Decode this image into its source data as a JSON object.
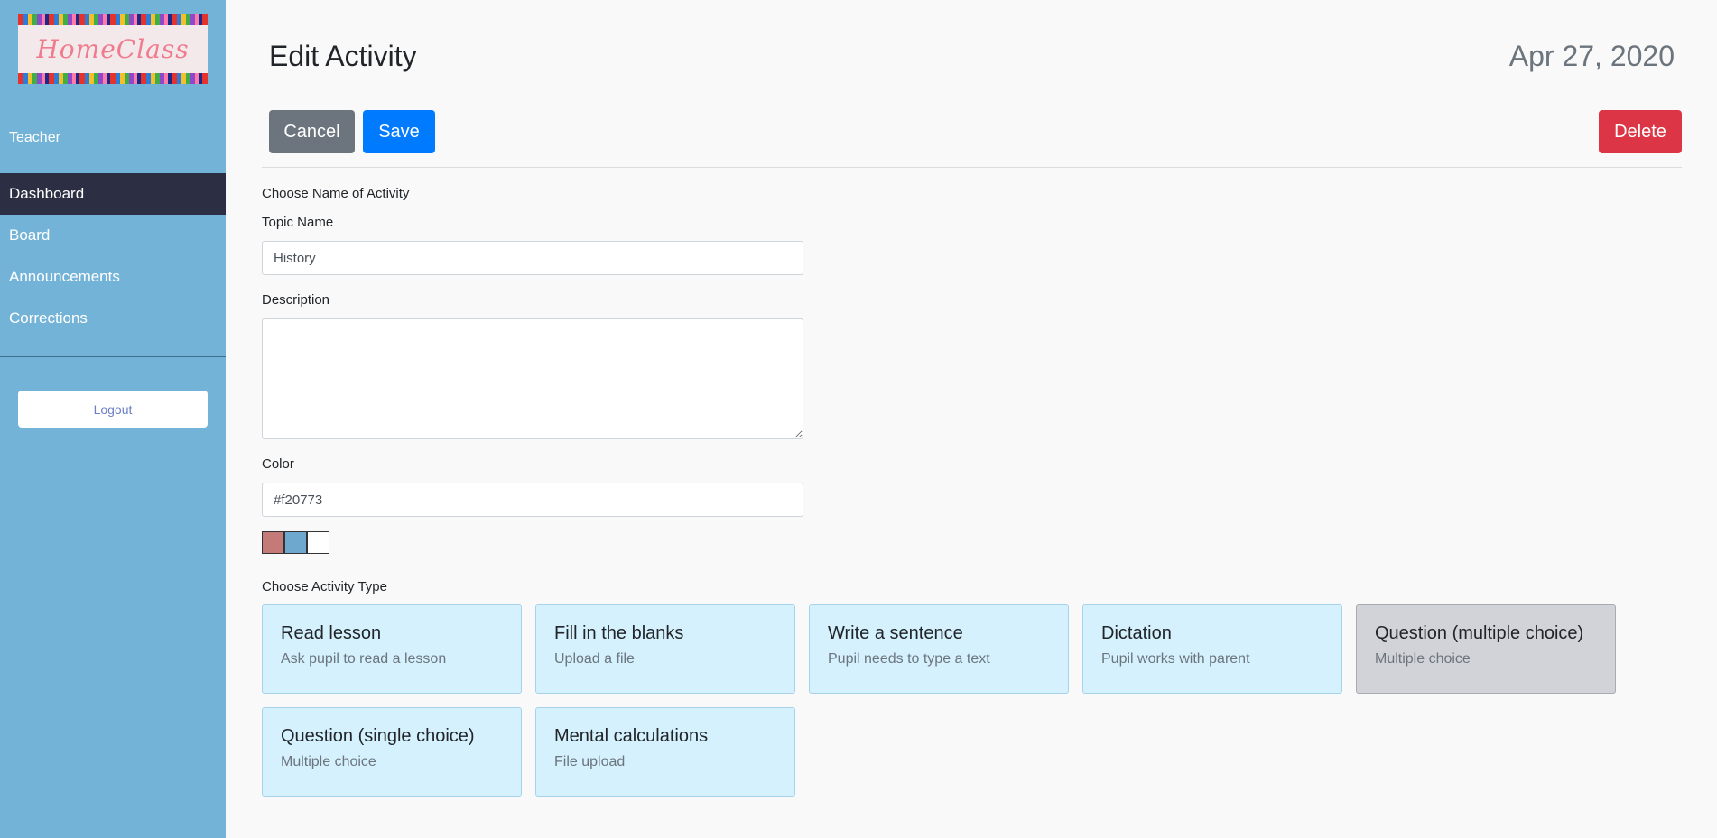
{
  "sidebar": {
    "logo_text": "HomeClass",
    "role": "Teacher",
    "nav": [
      {
        "label": "Dashboard",
        "active": true
      },
      {
        "label": "Board"
      },
      {
        "label": "Announcements"
      },
      {
        "label": "Corrections"
      }
    ],
    "logout_label": "Logout"
  },
  "header": {
    "title": "Edit Activity",
    "date": "Apr 27, 2020"
  },
  "toolbar": {
    "cancel_label": "Cancel",
    "save_label": "Save",
    "delete_label": "Delete"
  },
  "form": {
    "section_name_label": "Choose Name of Activity",
    "topic_label": "Topic Name",
    "topic_value": "History",
    "description_label": "Description",
    "description_value": "",
    "color_label": "Color",
    "color_value": "#f20773",
    "swatches": [
      "#c47a78",
      "#6ea8cf",
      "#ffffff"
    ],
    "activity_type_label": "Choose Activity Type"
  },
  "activity_types": [
    {
      "title": "Read lesson",
      "subtitle": "Ask pupil to read a lesson"
    },
    {
      "title": "Fill in the blanks",
      "subtitle": "Upload a file"
    },
    {
      "title": "Write a sentence",
      "subtitle": "Pupil needs to type a text"
    },
    {
      "title": "Dictation",
      "subtitle": "Pupil works with parent"
    },
    {
      "title": "Question (multiple choice)",
      "subtitle": "Multiple choice",
      "selected": true
    },
    {
      "title": "Question (single choice)",
      "subtitle": "Multiple choice"
    },
    {
      "title": "Mental calculations",
      "subtitle": "File upload"
    }
  ],
  "colors": {
    "sidebar_bg": "#74b3d8",
    "nav_active_bg": "#2c2f44",
    "card_bg": "#d4f1fd",
    "card_selected_bg": "#d2d3d8"
  }
}
